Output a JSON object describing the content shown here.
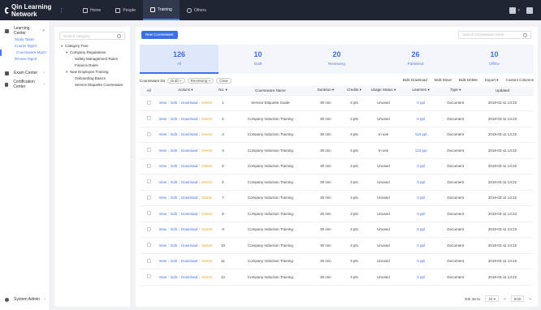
{
  "app": {
    "title": "Qin Learning Network"
  },
  "topnav": [
    {
      "label": "Home"
    },
    {
      "label": "People"
    },
    {
      "label": "Training"
    },
    {
      "label": "Others"
    }
  ],
  "sidebar": {
    "groups": [
      {
        "label": "Learning Center",
        "subs": [
          "Study Tasks",
          "Course Mgmt",
          "Courseware Mgmt",
          "Review Mgmt"
        ]
      },
      {
        "label": "Exam Center",
        "subs": []
      },
      {
        "label": "Certification Center",
        "subs": []
      }
    ],
    "bottom": "System Admin"
  },
  "tree": {
    "search_placeholder": "Search category",
    "nodes": [
      {
        "label": "Category Tree",
        "level": 0,
        "caret": "▾"
      },
      {
        "label": "Company Regulations",
        "level": 1,
        "caret": "▾"
      },
      {
        "label": "Safety Management Rules",
        "level": 2,
        "caret": ""
      },
      {
        "label": "Finance Rules",
        "level": 2,
        "caret": ""
      },
      {
        "label": "New Employee Training",
        "level": 1,
        "caret": "▾"
      },
      {
        "label": "Onboarding Basics",
        "level": 2,
        "caret": ""
      },
      {
        "label": "Service Etiquette Courseware",
        "level": 2,
        "caret": ""
      }
    ]
  },
  "main": {
    "add_button": "New Courseware",
    "search_placeholder": "Search courseware name...",
    "stats": [
      {
        "num": "126",
        "label": "All"
      },
      {
        "num": "10",
        "label": "Draft"
      },
      {
        "num": "20",
        "label": "Reviewing"
      },
      {
        "num": "26",
        "label": "Published"
      },
      {
        "num": "10",
        "label": "Offline"
      }
    ],
    "filter_label": "Courseware list",
    "filter_tags": [
      "Draft ×",
      "Reviewing ×",
      "Clear"
    ],
    "tools": [
      "Bulk Download",
      "Bulk Move",
      "Bulk Delete",
      "Export ▾",
      "Custom Columns"
    ],
    "columns": [
      "All",
      "Actions ▾",
      "No. ▾",
      "Courseware Name",
      "Duration ▾",
      "Credits ▾",
      "Usage Status ▾",
      "Learners ▾",
      "Type ▾",
      "Updated"
    ],
    "ops": {
      "view": "View",
      "edit": "Edit",
      "download": "Download",
      "delete": "Delete"
    },
    "rows": [
      {
        "no": "1",
        "name": "Service Etiquette Guide",
        "dur": "30 min",
        "credit": "3 pts",
        "status": "Unused",
        "count": "0 ppl",
        "type": "Document",
        "time": "2019-03-11 14:22"
      },
      {
        "no": "2",
        "name": "Company Induction Training",
        "dur": "30 min",
        "credit": "3 pts",
        "status": "Unused",
        "count": "0 ppl",
        "type": "Document",
        "time": "2019-03-11 14:22"
      },
      {
        "no": "3",
        "name": "Company Induction Training",
        "dur": "30 min",
        "credit": "3 pts",
        "status": "In use",
        "count": "123 ppl",
        "type": "Document",
        "time": "2019-03-11 14:22"
      },
      {
        "no": "4",
        "name": "Company Induction Training",
        "dur": "30 min",
        "credit": "3 pts",
        "status": "In use",
        "count": "123 ppl",
        "type": "Document",
        "time": "2019-03-11 14:22"
      },
      {
        "no": "5",
        "name": "Company Induction Training",
        "dur": "30 min",
        "credit": "3 pts",
        "status": "Unused",
        "count": "0 ppl",
        "type": "Document",
        "time": "2019-03-11 14:22"
      },
      {
        "no": "6",
        "name": "Company Induction Training",
        "dur": "30 min",
        "credit": "3 pts",
        "status": "Unused",
        "count": "0 ppl",
        "type": "Document",
        "time": "2019-03-11 14:22"
      },
      {
        "no": "7",
        "name": "Company Induction Training",
        "dur": "30 min",
        "credit": "3 pts",
        "status": "Unused",
        "count": "0 ppl",
        "type": "Document",
        "time": "2019-03-11 14:22"
      },
      {
        "no": "8",
        "name": "Company Induction Training",
        "dur": "30 min",
        "credit": "3 pts",
        "status": "Unused",
        "count": "0 ppl",
        "type": "Document",
        "time": "2019-03-11 14:22"
      },
      {
        "no": "9",
        "name": "Company Induction Training",
        "dur": "30 min",
        "credit": "3 pts",
        "status": "Unused",
        "count": "0 ppl",
        "type": "Document",
        "time": "2019-03-11 14:22"
      },
      {
        "no": "10",
        "name": "Company Induction Training",
        "dur": "30 min",
        "credit": "3 pts",
        "status": "Unused",
        "count": "0 ppl",
        "type": "Document",
        "time": "2019-03-11 14:22"
      },
      {
        "no": "11",
        "name": "Company Induction Training",
        "dur": "30 min",
        "credit": "3 pts",
        "status": "Unused",
        "count": "0 ppl",
        "type": "Document",
        "time": "2019-03-11 14:22"
      },
      {
        "no": "12",
        "name": "Company Induction Training",
        "dur": "30 min",
        "credit": "3 pts",
        "status": "Unused",
        "count": "0 ppl",
        "type": "Document",
        "time": "2019-03-11 14:22"
      }
    ],
    "pager": {
      "total": "306 items",
      "size": "15 ▾",
      "prev": "<",
      "page": "6/30",
      "next": ">"
    }
  },
  "colors": {
    "accent": "#3d6fe8",
    "topbar": "#1f2533",
    "delete": "#f5a623"
  }
}
